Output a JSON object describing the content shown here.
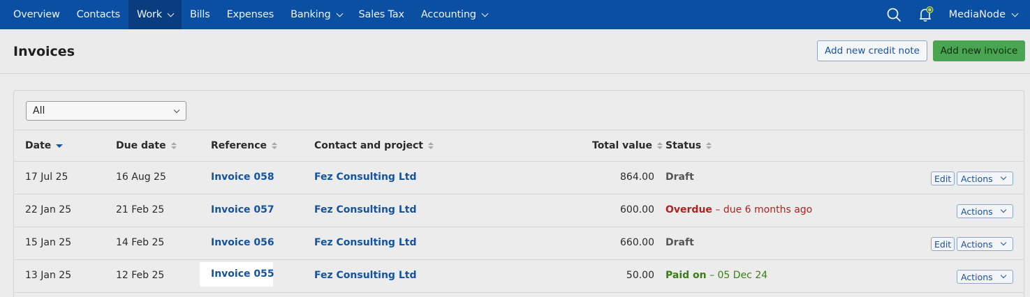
{
  "nav": {
    "items": [
      {
        "label": "Overview",
        "dropdown": false,
        "active": false
      },
      {
        "label": "Contacts",
        "dropdown": false,
        "active": false
      },
      {
        "label": "Work",
        "dropdown": true,
        "active": true
      },
      {
        "label": "Bills",
        "dropdown": false,
        "active": false
      },
      {
        "label": "Expenses",
        "dropdown": false,
        "active": false
      },
      {
        "label": "Banking",
        "dropdown": true,
        "active": false
      },
      {
        "label": "Sales Tax",
        "dropdown": false,
        "active": false
      },
      {
        "label": "Accounting",
        "dropdown": true,
        "active": false
      }
    ],
    "org_name": "MediaNode",
    "icons": [
      "search-icon",
      "bell-icon",
      "chevron-down-icon"
    ],
    "colors": {
      "nav_bg": "#0b4fa3",
      "active_bg": "#0a3d80",
      "notification_dot": "#c7d930"
    }
  },
  "header": {
    "title": "Invoices",
    "credit_note_label": "Add new credit note",
    "new_invoice_label": "Add new invoice"
  },
  "filter": {
    "selected": "All"
  },
  "table": {
    "columns": {
      "date": "Date",
      "due_date": "Due date",
      "reference": "Reference",
      "contact": "Contact and project",
      "total": "Total value",
      "status": "Status"
    },
    "sorted_by": "date",
    "rows": [
      {
        "date": "17 Jul 25",
        "due": "16 Aug 25",
        "reference": "Invoice 058",
        "contact": "Fez Consulting Ltd",
        "total": "864.00",
        "status": "Draft",
        "status_note": "",
        "edit": "Edit",
        "actions": "Actions"
      },
      {
        "date": "22 Jan 25",
        "due": "21 Feb 25",
        "reference": "Invoice 057",
        "contact": "Fez Consulting Ltd",
        "total": "600.00",
        "status": "Overdue",
        "status_note": "– due 6 months ago",
        "edit": "",
        "actions": "Actions"
      },
      {
        "date": "15 Jan 25",
        "due": "14 Feb 25",
        "reference": "Invoice 056",
        "contact": "Fez Consulting Ltd",
        "total": "660.00",
        "status": "Draft",
        "status_note": "",
        "edit": "Edit",
        "actions": "Actions"
      },
      {
        "date": "13 Jan 25",
        "due": "12 Feb 25",
        "reference": "Invoice 055",
        "contact": "Fez Consulting Ltd",
        "total": "50.00",
        "status": "Paid on",
        "status_note": "– 05 Dec 24",
        "edit": "",
        "actions": "Actions"
      }
    ]
  }
}
